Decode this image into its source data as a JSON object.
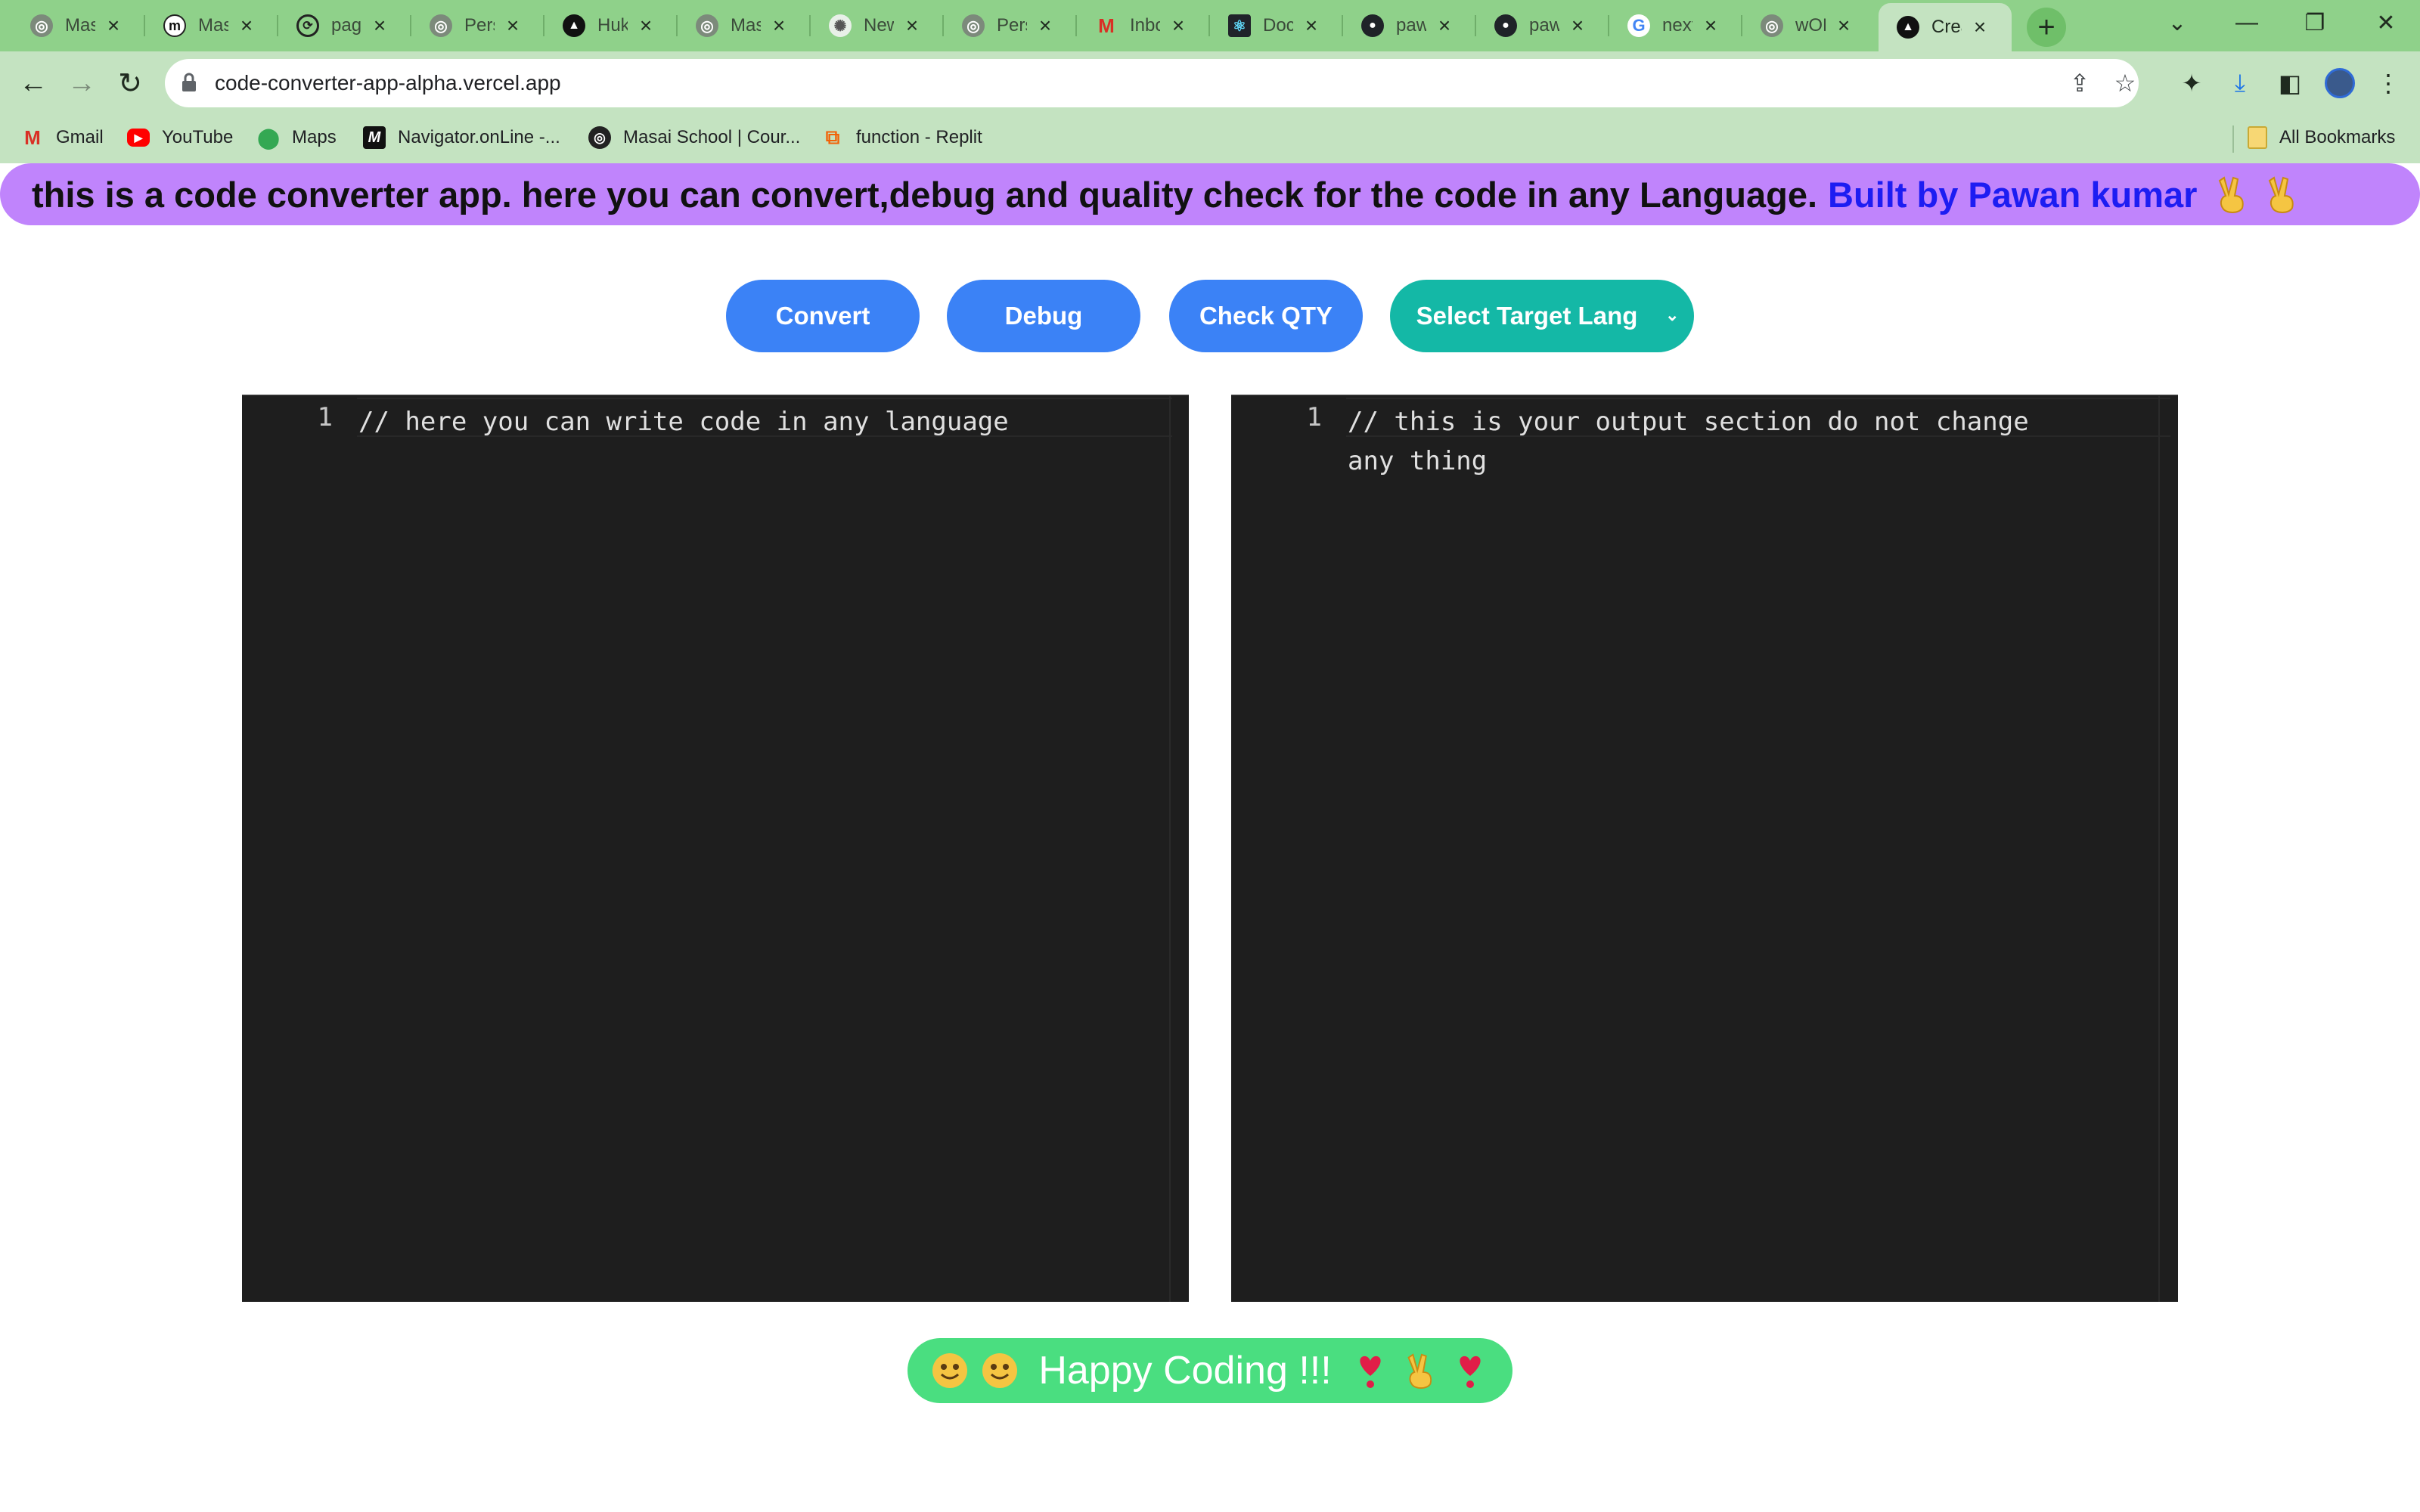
{
  "browser": {
    "tabs": [
      {
        "label": "Masai",
        "icon": "globe-icon"
      },
      {
        "label": "Masai",
        "icon": "medium-m-icon"
      },
      {
        "label": "pages",
        "icon": "github-sync-icon"
      },
      {
        "label": "Personal",
        "icon": "globe-icon"
      },
      {
        "label": "Huku",
        "icon": "vercel-triangle-icon"
      },
      {
        "label": "Masai",
        "icon": "globe-icon"
      },
      {
        "label": "New",
        "icon": "openai-icon"
      },
      {
        "label": "Personal",
        "icon": "globe-icon"
      },
      {
        "label": "Inbox",
        "icon": "gmail-icon"
      },
      {
        "label": "Docs",
        "icon": "react-icon"
      },
      {
        "label": "pawan",
        "icon": "github-icon"
      },
      {
        "label": "pawan",
        "icon": "github-icon"
      },
      {
        "label": "next",
        "icon": "google-icon"
      },
      {
        "label": "wOH",
        "icon": "globe-icon"
      },
      {
        "label": "Create",
        "icon": "vercel-triangle-icon",
        "active": true
      }
    ],
    "url": "code-converter-app-alpha.vercel.app",
    "bookmarks": [
      {
        "label": "Gmail",
        "icon": "gmail-icon"
      },
      {
        "label": "YouTube",
        "icon": "youtube-icon"
      },
      {
        "label": "Maps",
        "icon": "maps-pin-icon"
      },
      {
        "label": "Navigator.onLine -...",
        "icon": "navigator-m-icon"
      },
      {
        "label": "Masai School | Cour...",
        "icon": "globe-icon"
      },
      {
        "label": "function - Replit",
        "icon": "replit-icon"
      }
    ],
    "all_bookmarks": "All Bookmarks"
  },
  "banner": {
    "text": "this is a code converter app. here you can convert,debug and quality check for the code in any Language.",
    "author": "Built by Pawan kumar"
  },
  "actions": {
    "convert": "Convert",
    "debug": "Debug",
    "check": "Check QTY",
    "select_lang": "Select Target Lang"
  },
  "editors": {
    "input": {
      "line": "1",
      "code": "// here you can write code in any language"
    },
    "output": {
      "line": "1",
      "code": "// this is your output section do not change\nany thing"
    }
  },
  "footer": {
    "text": "Happy Coding !!!"
  },
  "colors": {
    "banner_bg": "#c084fc",
    "author": "#1d1df2",
    "button_blue": "#3b82f6",
    "button_teal": "#14b8a6",
    "editor_bg": "#1e1e1e",
    "footer_bg": "#4ade80"
  }
}
